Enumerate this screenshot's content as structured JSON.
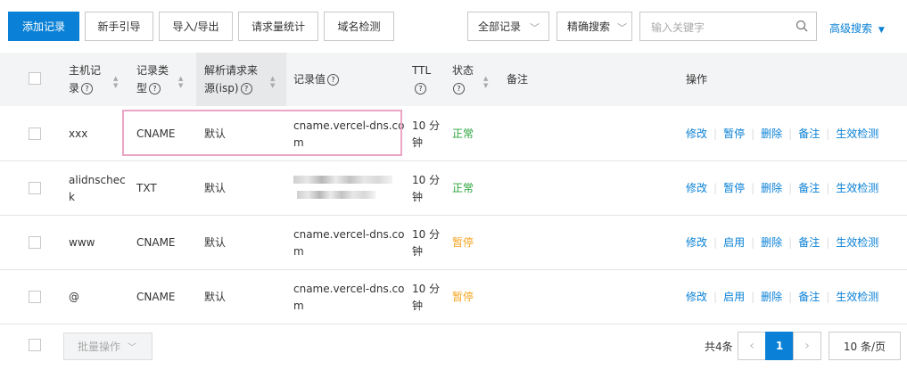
{
  "toolbar": {
    "add_record": "添加记录",
    "guide": "新手引导",
    "import_export": "导入/导出",
    "stats": "请求量统计",
    "domain_check": "域名检测",
    "filter_all": "全部记录",
    "search_mode": "精确搜索",
    "search_placeholder": "输入关键字",
    "advanced_search": "高级搜索"
  },
  "table": {
    "headers": {
      "host_l1": "主机记",
      "host_l2": "录",
      "type_l1": "记录类",
      "type_l2": "型",
      "isp_l1": "解析请求来",
      "isp_l2": "源(isp)",
      "value": "记录值",
      "ttl": "TTL",
      "status": "状态",
      "remark": "备注",
      "actions": "操作"
    },
    "rows": [
      {
        "host_l1": "xxx",
        "host_l2": "",
        "type": "CNAME",
        "isp": "默认",
        "value_l1": "cname.vercel-dns.co",
        "value_l2": "m",
        "ttl_l1": "10 分",
        "ttl_l2": "钟",
        "status": "正常",
        "actions": [
          "修改",
          "暂停",
          "删除",
          "备注",
          "生效检测"
        ]
      },
      {
        "host_l1": "alidnschec",
        "host_l2": "k",
        "type": "TXT",
        "isp": "默认",
        "value_l1": "",
        "value_l2": "",
        "ttl_l1": "10 分",
        "ttl_l2": "钟",
        "status": "正常",
        "actions": [
          "修改",
          "暂停",
          "删除",
          "备注",
          "生效检测"
        ]
      },
      {
        "host_l1": "www",
        "host_l2": "",
        "type": "CNAME",
        "isp": "默认",
        "value_l1": "cname.vercel-dns.co",
        "value_l2": "m",
        "ttl_l1": "10 分",
        "ttl_l2": "钟",
        "status": "暂停",
        "actions": [
          "修改",
          "启用",
          "删除",
          "备注",
          "生效检测"
        ]
      },
      {
        "host_l1": "@",
        "host_l2": "",
        "type": "CNAME",
        "isp": "默认",
        "value_l1": "cname.vercel-dns.co",
        "value_l2": "m",
        "ttl_l1": "10 分",
        "ttl_l2": "钟",
        "status": "暂停",
        "actions": [
          "修改",
          "启用",
          "删除",
          "备注",
          "生效检测"
        ]
      }
    ]
  },
  "footer": {
    "bulk_action": "批量操作",
    "total": "共4条",
    "page_prev": "‹",
    "current_page": "1",
    "page_next": "›",
    "page_size": "10 条/页"
  },
  "colors": {
    "primary": "#0a81d6",
    "ok": "#2aa33a",
    "paused": "#f5a623",
    "highlight": "#eba5c4"
  }
}
